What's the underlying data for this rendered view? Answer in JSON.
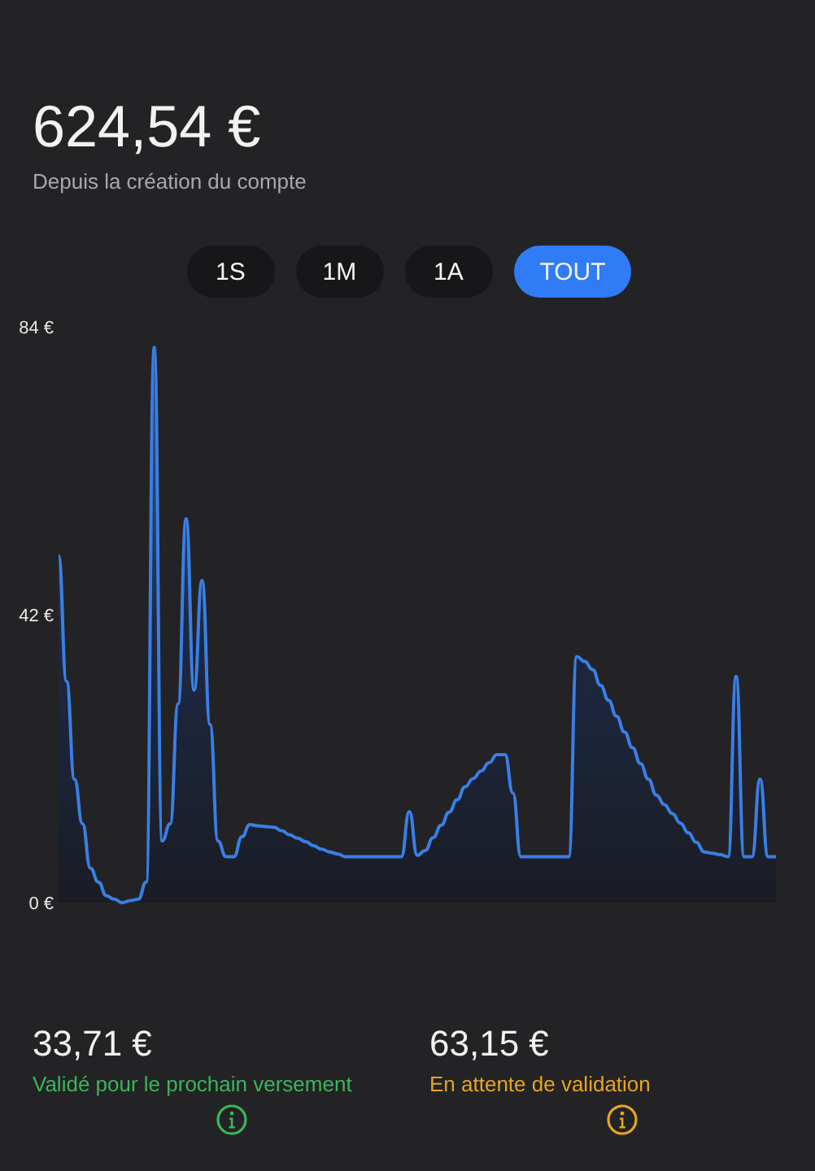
{
  "balance": {
    "amount": "624,54 €",
    "caption": "Depuis la création du compte"
  },
  "periods": [
    {
      "label": "1S",
      "selected": false
    },
    {
      "label": "1M",
      "selected": false
    },
    {
      "label": "1A",
      "selected": false
    },
    {
      "label": "TOUT",
      "selected": true
    }
  ],
  "chart": {
    "chart_data": {
      "type": "area",
      "ylim": [
        0,
        84
      ],
      "yticks": [
        {
          "value": 0,
          "label": "0 €"
        },
        {
          "value": 42,
          "label": "42 €"
        },
        {
          "value": 84,
          "label": "84 €"
        }
      ],
      "series": [
        {
          "color": "#3a7fe6",
          "values": [
            50.6,
            32.3,
            18,
            11.5,
            5,
            3,
            1,
            0.5,
            0,
            0.3,
            0.5,
            3,
            81,
            9,
            11.5,
            29,
            56,
            31,
            47,
            26,
            9,
            6.7,
            6.7,
            9.6,
            11.4,
            11.2,
            11.1,
            11,
            10.5,
            9.9,
            9.4,
            8.9,
            8.3,
            7.8,
            7.4,
            7.1,
            6.7,
            6.7,
            6.7,
            6.7,
            6.7,
            6.7,
            6.7,
            6.7,
            13.3,
            6.9,
            7.6,
            9.5,
            11.3,
            13.2,
            15,
            16.9,
            18.1,
            19.2,
            20.4,
            21.6,
            21.6,
            16,
            6.7,
            6.7,
            6.7,
            6.7,
            6.7,
            6.7,
            6.7,
            35.9,
            35.2,
            34,
            31.7,
            29.5,
            27.2,
            24.9,
            22.6,
            20.3,
            18,
            15.7,
            14.3,
            13,
            11.6,
            10.2,
            8.8,
            7.4,
            7.2,
            7,
            6.7,
            33,
            6.7,
            6.7,
            18,
            6.7,
            6.7
          ]
        }
      ]
    }
  },
  "stats": [
    {
      "amount": "33,71 €",
      "label": "Validé pour le prochain versement",
      "color": "#3cb55a"
    },
    {
      "amount": "63,15 €",
      "label": "En attente de validation",
      "color": "#e6a521"
    }
  ]
}
